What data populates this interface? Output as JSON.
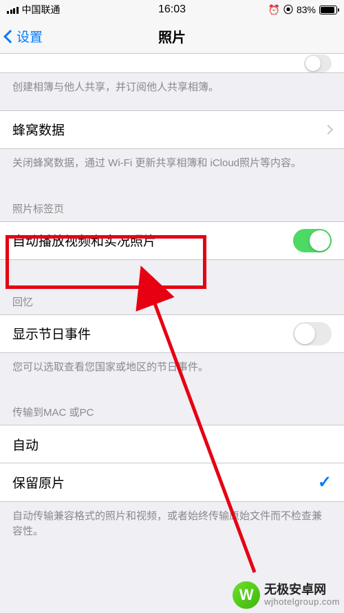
{
  "status": {
    "carrier": "中国联通",
    "time": "16:03",
    "battery_pct": "83%"
  },
  "nav": {
    "back_label": "设置",
    "title": "照片"
  },
  "sections": {
    "sharing_footer": "创建相簿与他人共享，并订阅他人共享相簿。",
    "cellular": {
      "label": "蜂窝数据"
    },
    "cellular_footer": "关闭蜂窝数据，通过 Wi-Fi 更新共享相簿和 iCloud照片等内容。",
    "tabs_header": "照片标签页",
    "autoplay": {
      "label": "自动播放视频和实况照片",
      "on": true
    },
    "memories_header": "回忆",
    "holidays": {
      "label": "显示节日事件",
      "on": false
    },
    "holidays_footer": "您可以选取查看您国家或地区的节日事件。",
    "transfer_header": "传输到MAC 或PC",
    "auto": {
      "label": "自动"
    },
    "keep_original": {
      "label": "保留原片",
      "checked": true
    },
    "transfer_footer": "自动传输兼容格式的照片和视频，或者始终传输原始文件而不检查兼容性。"
  },
  "watermark": {
    "line1": "无极安卓网",
    "line2": "wjhotelgroup.com"
  }
}
